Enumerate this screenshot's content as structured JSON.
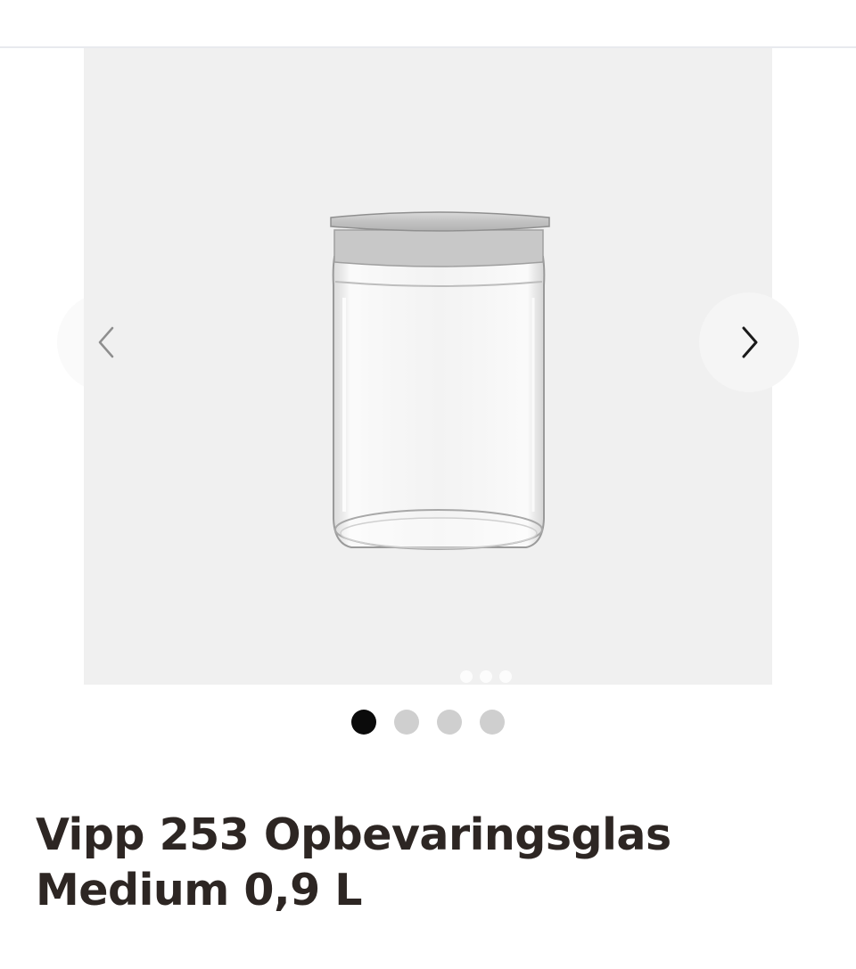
{
  "header": {},
  "gallery": {
    "image_alt": "Vipp 253 Opbevaringsglas Medium 0,9 L",
    "prev_icon": "chevron-left-icon",
    "next_icon": "chevron-right-icon",
    "slide_count": 4,
    "active_slide": 1
  },
  "product": {
    "title_line1": "Vipp 253 Opbevaringsglas",
    "title_line2": "Medium 0,9 L"
  },
  "colors": {
    "image_background": "#f0f0f0",
    "dot_active": "#0b0b0b",
    "dot_inactive": "#cfcfcf",
    "title_text": "#2d2623"
  }
}
